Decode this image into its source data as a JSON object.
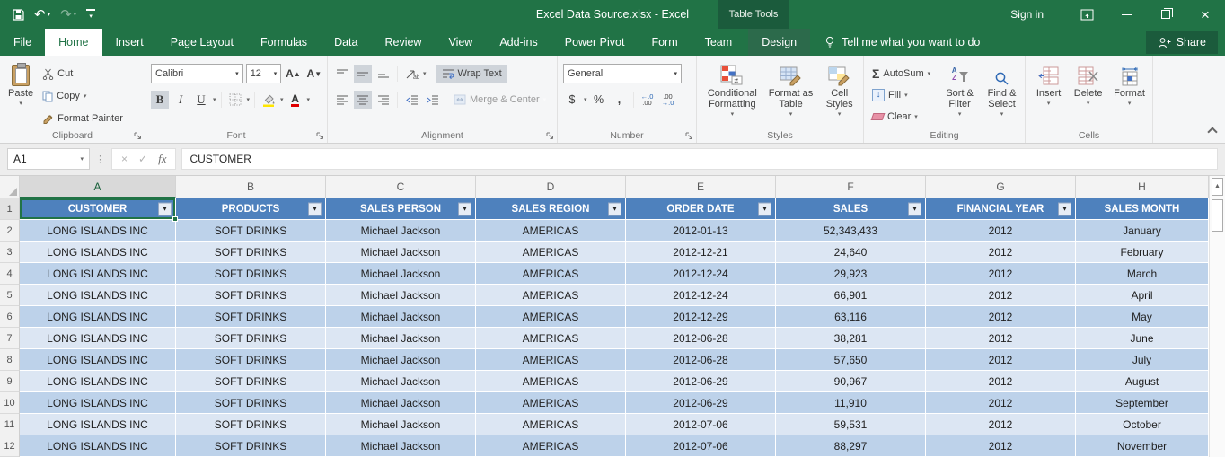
{
  "window": {
    "title": "Excel Data Source.xlsx  -  Excel",
    "contextual_tab_group": "Table Tools",
    "sign_in": "Sign in"
  },
  "tab_bar": {
    "tabs": [
      {
        "id": "file",
        "label": "File"
      },
      {
        "id": "home",
        "label": "Home",
        "active": true
      },
      {
        "id": "insert",
        "label": "Insert"
      },
      {
        "id": "page-layout",
        "label": "Page Layout"
      },
      {
        "id": "formulas",
        "label": "Formulas"
      },
      {
        "id": "data",
        "label": "Data"
      },
      {
        "id": "review",
        "label": "Review"
      },
      {
        "id": "view",
        "label": "View"
      },
      {
        "id": "add-ins",
        "label": "Add-ins"
      },
      {
        "id": "power-pivot",
        "label": "Power Pivot"
      },
      {
        "id": "form",
        "label": "Form"
      },
      {
        "id": "team",
        "label": "Team"
      },
      {
        "id": "design",
        "label": "Design",
        "contextual": true
      }
    ],
    "tell_me": "Tell me what you want to do",
    "share": "Share"
  },
  "ribbon": {
    "clipboard": {
      "label": "Clipboard",
      "paste": "Paste",
      "cut": "Cut",
      "copy": "Copy",
      "format_painter": "Format Painter"
    },
    "font": {
      "label": "Font",
      "font_name": "Calibri",
      "font_size": "12",
      "bold": "B",
      "italic": "I",
      "underline": "U",
      "font_color_glyph": "A"
    },
    "alignment": {
      "label": "Alignment",
      "wrap_text": "Wrap Text",
      "merge_center": "Merge & Center"
    },
    "number": {
      "label": "Number",
      "format": "General",
      "currency": "$",
      "percent": "%",
      "comma": ","
    },
    "styles": {
      "label": "Styles",
      "conditional_formatting": "Conditional Formatting",
      "format_as_table": "Format as Table",
      "cell_styles": "Cell Styles"
    },
    "editing": {
      "label": "Editing",
      "autosum": "AutoSum",
      "fill": "Fill",
      "clear": "Clear",
      "sort_filter": "Sort & Filter",
      "find_select": "Find & Select"
    },
    "cells": {
      "label": "Cells",
      "insert": "Insert",
      "delete": "Delete",
      "format": "Format"
    }
  },
  "formula_bar": {
    "name_box": "A1",
    "fx_label": "fx",
    "formula": "CUSTOMER"
  },
  "sheet": {
    "selected_cell": "A1",
    "column_letters": [
      "A",
      "B",
      "C",
      "D",
      "E",
      "F",
      "G",
      "H"
    ],
    "header_row_number": "1",
    "headers": [
      "CUSTOMER",
      "PRODUCTS",
      "SALES PERSON",
      "SALES REGION",
      "ORDER DATE",
      "SALES",
      "FINANCIAL YEAR",
      "SALES MONTH"
    ],
    "rows": [
      {
        "n": "2",
        "cells": [
          "LONG ISLANDS INC",
          "SOFT DRINKS",
          "Michael Jackson",
          "AMERICAS",
          "2012-01-13",
          "52,343,433",
          "2012",
          "January"
        ]
      },
      {
        "n": "3",
        "cells": [
          "LONG ISLANDS INC",
          "SOFT DRINKS",
          "Michael Jackson",
          "AMERICAS",
          "2012-12-21",
          "24,640",
          "2012",
          "February"
        ]
      },
      {
        "n": "4",
        "cells": [
          "LONG ISLANDS INC",
          "SOFT DRINKS",
          "Michael Jackson",
          "AMERICAS",
          "2012-12-24",
          "29,923",
          "2012",
          "March"
        ]
      },
      {
        "n": "5",
        "cells": [
          "LONG ISLANDS INC",
          "SOFT DRINKS",
          "Michael Jackson",
          "AMERICAS",
          "2012-12-24",
          "66,901",
          "2012",
          "April"
        ]
      },
      {
        "n": "6",
        "cells": [
          "LONG ISLANDS INC",
          "SOFT DRINKS",
          "Michael Jackson",
          "AMERICAS",
          "2012-12-29",
          "63,116",
          "2012",
          "May"
        ]
      },
      {
        "n": "7",
        "cells": [
          "LONG ISLANDS INC",
          "SOFT DRINKS",
          "Michael Jackson",
          "AMERICAS",
          "2012-06-28",
          "38,281",
          "2012",
          "June"
        ]
      },
      {
        "n": "8",
        "cells": [
          "LONG ISLANDS INC",
          "SOFT DRINKS",
          "Michael Jackson",
          "AMERICAS",
          "2012-06-28",
          "57,650",
          "2012",
          "July"
        ]
      },
      {
        "n": "9",
        "cells": [
          "LONG ISLANDS INC",
          "SOFT DRINKS",
          "Michael Jackson",
          "AMERICAS",
          "2012-06-29",
          "90,967",
          "2012",
          "August"
        ]
      },
      {
        "n": "10",
        "cells": [
          "LONG ISLANDS INC",
          "SOFT DRINKS",
          "Michael Jackson",
          "AMERICAS",
          "2012-06-29",
          "11,910",
          "2012",
          "September"
        ]
      },
      {
        "n": "11",
        "cells": [
          "LONG ISLANDS INC",
          "SOFT DRINKS",
          "Michael Jackson",
          "AMERICAS",
          "2012-07-06",
          "59,531",
          "2012",
          "October"
        ]
      },
      {
        "n": "12",
        "cells": [
          "LONG ISLANDS INC",
          "SOFT DRINKS",
          "Michael Jackson",
          "AMERICAS",
          "2012-07-06",
          "88,297",
          "2012",
          "November"
        ]
      }
    ]
  },
  "colors": {
    "title_green": "#217346",
    "contextual_badge_green": "#1B5B3C",
    "design_tab_green": "#2C6A4B",
    "table_header_blue": "#4E81BD",
    "band_dark_blue": "#BDD2EA",
    "band_light_blue": "#DCE6F3",
    "selection_green": "#217346"
  }
}
